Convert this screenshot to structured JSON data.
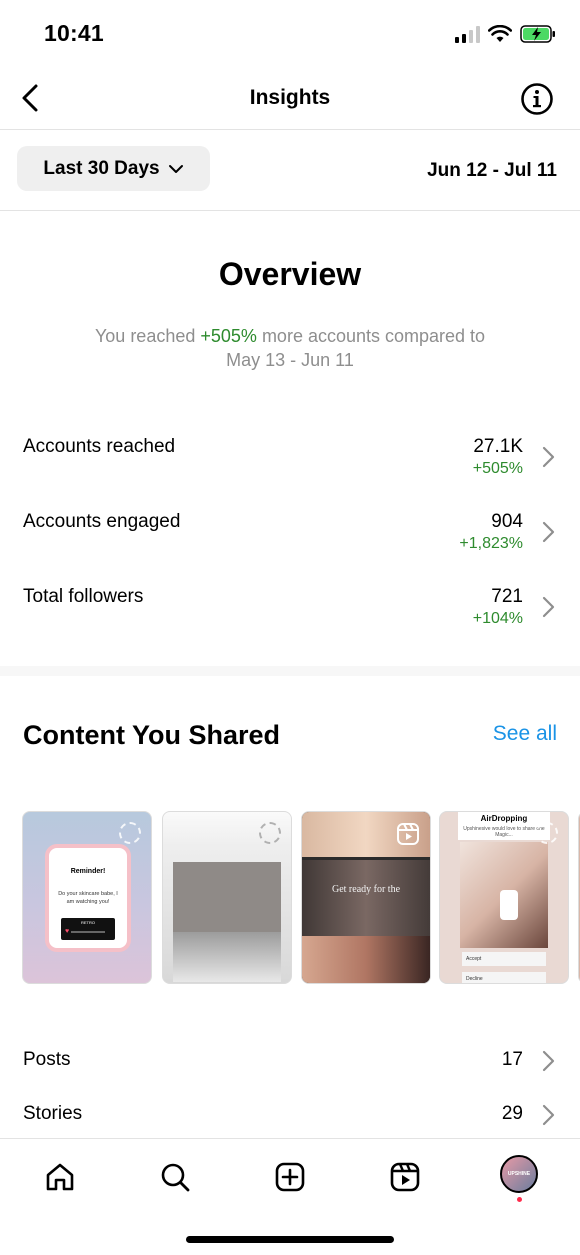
{
  "status_bar": {
    "time": "10:41"
  },
  "header": {
    "title": "Insights"
  },
  "filter": {
    "range_label": "Last 30 Days",
    "dates": "Jun 12 - Jul 11"
  },
  "overview": {
    "title": "Overview",
    "sub_prefix": "You reached ",
    "sub_highlight": "+505%",
    "sub_suffix": " more accounts compared to",
    "sub_line2": "May 13 - Jun 11",
    "metrics": [
      {
        "label": "Accounts reached",
        "value": "27.1K",
        "change": "+505%"
      },
      {
        "label": "Accounts engaged",
        "value": "904",
        "change": "+1,823%"
      },
      {
        "label": "Total followers",
        "value": "721",
        "change": "+104%"
      }
    ]
  },
  "content_shared": {
    "title": "Content You Shared",
    "see_all": "See all",
    "thumbs": {
      "t1_title": "Reminder!",
      "t1_body": "Do your skincare babe, I am watching you!",
      "t1_bar": "RETRO",
      "t3_text": "Get ready for the",
      "t4_title": "AirDropping",
      "t4_sub": "Upshinesive would love to share one Magic...",
      "t4_accept": "Accept",
      "t4_decline": "Decline"
    },
    "rows": [
      {
        "label": "Posts",
        "value": "17"
      },
      {
        "label": "Stories",
        "value": "29"
      }
    ]
  },
  "tab_bar": {
    "avatar_text": "UPSHINE"
  },
  "colors": {
    "positive": "#2e8b2e",
    "link": "#1a93e6"
  }
}
